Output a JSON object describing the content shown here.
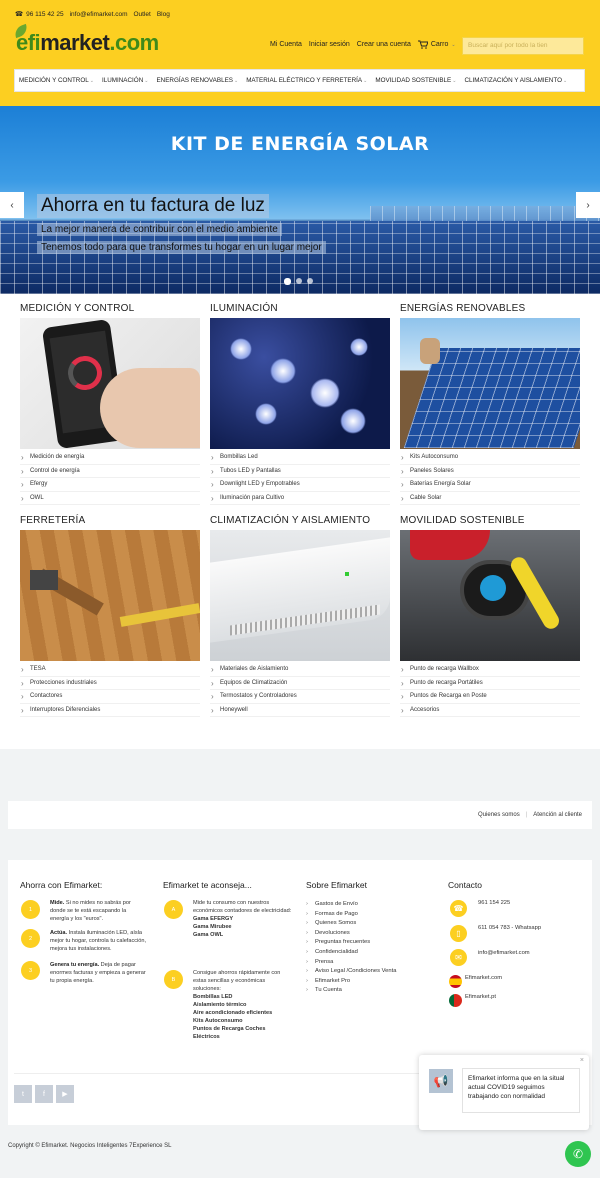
{
  "topbar": {
    "phone": "96 115 42 25",
    "email": "info@efimarket.com",
    "outlet": "Outlet",
    "blog": "Blog"
  },
  "logo": {
    "efi": "efi",
    "market": "market",
    "com": ".com"
  },
  "account": {
    "mi_cuenta": "Mi Cuenta",
    "login": "Iniciar sesión",
    "create": "Crear una cuenta",
    "cart": "Carro"
  },
  "search": {
    "placeholder": "Buscar aquí por todo la tien"
  },
  "menu": [
    "Medición y control",
    "Iluminación",
    "Energías renovables",
    "Material eléctrico y ferretería",
    "Movilidad sostenible",
    "Climatización y aislamiento"
  ],
  "hero": {
    "title": "KIT DE ENERGÍA SOLAR",
    "headline": "Ahorra en tu factura de luz",
    "sub1": "La mejor manera de contribuir con el medio ambiente",
    "sub2": "Tenemos todo para que transformes tu hogar en un lugar mejor"
  },
  "categories": [
    {
      "title": "MEDICIÓN Y CONTROL",
      "items": [
        "Medición de energía",
        "Control de energía",
        "Efergy",
        "OWL"
      ]
    },
    {
      "title": "ILUMINACIÓN",
      "items": [
        "Bombillas Led",
        "Tubos LED y Pantallas",
        "Downlight LED y Empotrables",
        "Iluminación para Cultivo"
      ]
    },
    {
      "title": "ENERGÍAS RENOVABLES",
      "items": [
        "Kits Autoconsumo",
        "Paneles Solares",
        "Baterías Energía Solar",
        "Cable Solar"
      ]
    },
    {
      "title": "FERRETERÍA",
      "items": [
        "TESA",
        "Protecciones industriales",
        "Contactores",
        "Interruptores Diferenciales"
      ]
    },
    {
      "title": "CLIMATIZACIÓN Y AISLAMIENTO",
      "items": [
        "Materiales de Aislamiento",
        "Equipos de Climatización",
        "Termostatos y Controladores",
        "Honeywell"
      ]
    },
    {
      "title": "MOVILIDAD SOSTENIBLE",
      "items": [
        "Punto de recarga Wallbox",
        "Punto de recarga Portátiles",
        "Puntos de Recarga en Poste",
        "Accesorios"
      ]
    }
  ],
  "infobar": {
    "about": "Quienes somos",
    "support": "Atención al cliente"
  },
  "footer": {
    "col1": {
      "title": "Ahorra con Efimarket:",
      "steps": [
        {
          "n": "1",
          "bold": "Mide.",
          "text": " Si no mides no sabrás por donde se te está escapando la energía y los \"euros\"."
        },
        {
          "n": "2",
          "bold": "Actúa.",
          "text": " Instala iluminación LED, aísla mejor tu hogar, controla tu calefacción, mejora tus instalaciones."
        },
        {
          "n": "3",
          "bold": "Genera tu energía.",
          "text": " Deja de pagar enormes facturas y empieza a generar tu propia energía."
        }
      ]
    },
    "col2": {
      "title": "Efimarket te aconseja...",
      "a": {
        "n": "A",
        "text": "Mide tu consumo con nuestros económicos contadores de electricidad:",
        "links": [
          "Gama EFERGY",
          "Gama Mirubee",
          "Gama OWL"
        ]
      },
      "b": {
        "n": "B",
        "text": "Consigue ahorros rápidamente con estas sencillas y económicas soluciones:",
        "links": [
          "Bombillas LED",
          "Aislamiento térmico",
          "Aire acondicionado eficientes",
          "Kits Autoconsumo",
          "Puntos de Recarga Coches Eléctricos"
        ]
      }
    },
    "col3": {
      "title": "Sobre Efimarket",
      "links": [
        "Gastos de Envío",
        "Formas de Pago",
        "Quienes Somos",
        "Devoluciones",
        "Preguntas frecuentes",
        "Confidencialidad",
        "Prensa",
        "Aviso Legal /Condiciones Venta",
        "Efimarket Pro",
        "Tu Cuenta"
      ]
    },
    "col4": {
      "title": "Contacto",
      "phone": "961 154 225",
      "whatsapp": "611 054 783 - Whatsapp",
      "email": "info@efimarket.com",
      "es": "Efimarket.com",
      "pt": "Efimarket.pt"
    }
  },
  "copyright": "Copyright © Efimarket. Negocios Inteligentes 7Experience SL",
  "popup": {
    "message": "Efimarket informa que en la situal actual COVID19 seguimos trabajando con normalidad"
  },
  "colors": {
    "brand_yellow": "#fccf21",
    "brand_green": "#3f8a1a",
    "whatsapp": "#2fc550"
  }
}
